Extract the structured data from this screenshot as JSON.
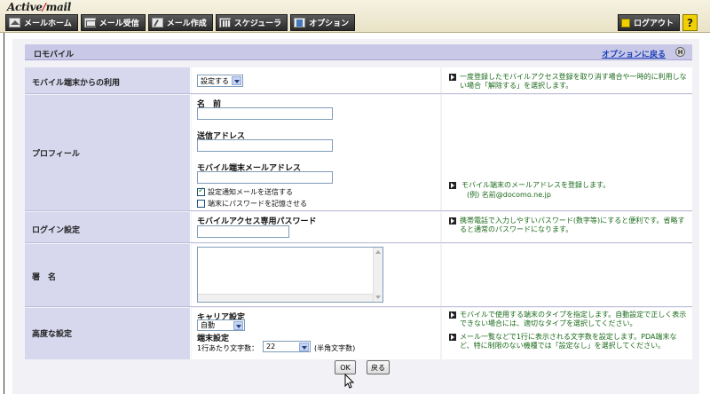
{
  "app": {
    "logo_pre": "Active",
    "logo_slash": "/",
    "logo_post": "mail"
  },
  "nav": {
    "items": [
      {
        "label": "メールホーム",
        "icon": "home-icon"
      },
      {
        "label": "メール受信",
        "icon": "envelope-icon"
      },
      {
        "label": "メール作成",
        "icon": "compose-icon"
      },
      {
        "label": "スケジューラ",
        "icon": "calendar-icon"
      },
      {
        "label": "オプション",
        "icon": "options-icon"
      }
    ],
    "logout_label": "ログアウト",
    "help_label": "?"
  },
  "section": {
    "title": "ロモバイル",
    "back_link": "オプションに戻る",
    "help_icon": "H"
  },
  "rows": {
    "usage": {
      "label": "モバイル端末からの利用",
      "select_value": "設定する",
      "desc": "一度登録したモバイルアクセス登録を取り消す場合や一時的に利用しない場合「解除する」を選択します。"
    },
    "profile": {
      "label": "プロフィール",
      "name_label": "名　前",
      "name_value": "",
      "sender_label": "送信アドレス",
      "sender_value": "",
      "mobile_label": "モバイル端末メールアドレス",
      "mobile_value": "",
      "chk1_label": "設定通知メールを送信する",
      "chk1_checked": true,
      "chk2_label": "端末にパスワードを記憶させる",
      "chk2_checked": false,
      "desc_line1": "モバイル端末のメールアドレスを登録します。",
      "desc_line2": "(例) 名前@docomo.ne.jp"
    },
    "login": {
      "label": "ログイン設定",
      "pw_label": "モバイルアクセス専用パスワード",
      "pw_value": "",
      "desc": "携帯電話で入力しやすいパスワード(数字等)にすると便利です。省略すると通常のパスワードになります。"
    },
    "signature": {
      "label": "署　名",
      "value": ""
    },
    "advanced": {
      "label": "高度な設定",
      "carrier_label": "キャリア設定",
      "carrier_value": "自動",
      "terminal_label": "端末設定",
      "chars_label": "1行あたり文字数：",
      "chars_value": "22",
      "chars_unit": "(半角文字数)",
      "desc1": "モバイルで使用する端末のタイプを指定します。自動設定で正しく表示できない場合には、適切なタイプを選択してください。",
      "desc2": "メール一覧などで1行に表示される文字数を設定します。PDA端末など、特に制限のない機種では「設定なし」を選択してください。"
    }
  },
  "buttons": {
    "ok": "OK",
    "back": "戻る"
  }
}
